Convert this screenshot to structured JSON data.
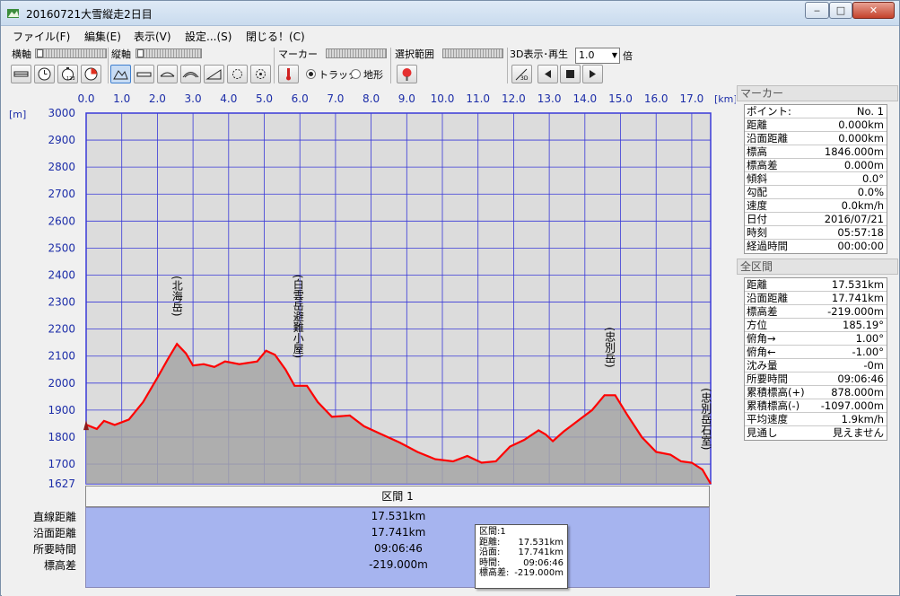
{
  "window": {
    "title": "20160721大雪縦走2日目",
    "min_label": "‒",
    "max_label": "□",
    "close_label": "✕"
  },
  "menu": [
    "ファイル(F)",
    "編集(E)",
    "表示(V)",
    "設定...(S)",
    "閉じる！(C)"
  ],
  "toolbar": {
    "x_axis_label": "横軸",
    "y_axis_label": "縦軸",
    "marker_label": "マーカー",
    "track_label": "トラック",
    "terrain_label": "地形",
    "selection_label": "選択範囲",
    "play3d_label": "3D表示･再生",
    "speed_value": "1.0",
    "speed_unit": "倍",
    "speed_options_icon": "chevron-down-icon",
    "x_buttons": [
      "horizontal-distance-icon",
      "clock-icon",
      "stopwatch-icon",
      "pie-icon"
    ],
    "y_buttons": [
      "mountain-icon",
      "flat-icon",
      "arc-icon",
      "wide-arc-icon",
      "slope-icon",
      "gear-icon",
      "gear2-icon"
    ],
    "marker_btn_icon": "thermometer-icon",
    "selection_btn_icon": "pin-icon",
    "play_buttons": [
      "3d-view-icon",
      "rewind-icon",
      "stop-icon",
      "play-icon"
    ]
  },
  "chart_data": {
    "type": "area",
    "x_unit": "[km]",
    "y_unit": "[m]",
    "x_ticks": [
      "0.0",
      "1.0",
      "2.0",
      "3.0",
      "4.0",
      "5.0",
      "6.0",
      "7.0",
      "8.0",
      "9.0",
      "10.0",
      "11.0",
      "12.0",
      "13.0",
      "14.0",
      "15.0",
      "16.0",
      "17.0"
    ],
    "y_ticks": [
      "3000",
      "2900",
      "2800",
      "2700",
      "2600",
      "2500",
      "2400",
      "2300",
      "2200",
      "2100",
      "2000",
      "1900",
      "1800",
      "1700",
      "1627"
    ],
    "xlim": [
      0,
      17.531
    ],
    "ylim": [
      1627,
      3000
    ],
    "fill_color": "#a6a6a6",
    "line_color": "#ff0000",
    "plot_bg": "#dcdcdc",
    "grid_color": "#3a3ad8",
    "points": [
      [
        0.0,
        1846
      ],
      [
        0.3,
        1830
      ],
      [
        0.5,
        1860
      ],
      [
        0.8,
        1845
      ],
      [
        1.2,
        1865
      ],
      [
        1.6,
        1930
      ],
      [
        2.0,
        2020
      ],
      [
        2.3,
        2090
      ],
      [
        2.55,
        2145
      ],
      [
        2.8,
        2110
      ],
      [
        3.0,
        2065
      ],
      [
        3.3,
        2070
      ],
      [
        3.6,
        2060
      ],
      [
        3.9,
        2080
      ],
      [
        4.3,
        2070
      ],
      [
        4.8,
        2080
      ],
      [
        5.05,
        2120
      ],
      [
        5.3,
        2105
      ],
      [
        5.6,
        2050
      ],
      [
        5.85,
        1990
      ],
      [
        6.2,
        1990
      ],
      [
        6.5,
        1930
      ],
      [
        6.9,
        1875
      ],
      [
        7.4,
        1880
      ],
      [
        7.8,
        1840
      ],
      [
        8.3,
        1810
      ],
      [
        8.8,
        1780
      ],
      [
        9.3,
        1745
      ],
      [
        9.8,
        1718
      ],
      [
        10.3,
        1710
      ],
      [
        10.7,
        1730
      ],
      [
        11.1,
        1705
      ],
      [
        11.5,
        1710
      ],
      [
        11.9,
        1765
      ],
      [
        12.3,
        1790
      ],
      [
        12.7,
        1825
      ],
      [
        12.9,
        1810
      ],
      [
        13.1,
        1785
      ],
      [
        13.4,
        1820
      ],
      [
        13.8,
        1860
      ],
      [
        14.2,
        1900
      ],
      [
        14.55,
        1955
      ],
      [
        14.85,
        1955
      ],
      [
        15.2,
        1880
      ],
      [
        15.6,
        1800
      ],
      [
        16.0,
        1745
      ],
      [
        16.4,
        1735
      ],
      [
        16.7,
        1710
      ],
      [
        17.0,
        1705
      ],
      [
        17.3,
        1680
      ],
      [
        17.531,
        1627
      ]
    ],
    "peaks": [
      {
        "label": "(北海岳)",
        "km": 2.55,
        "elev": 2145
      },
      {
        "label": "(白雲岳避難小屋)",
        "km": 5.95,
        "elev": 1990
      },
      {
        "label": "(忠別岳)",
        "km": 14.7,
        "elev": 1955
      },
      {
        "label": "(忠別岳石室)",
        "km": 17.4,
        "elev": 1650
      }
    ]
  },
  "interval": {
    "header": "区間 1",
    "rows": [
      {
        "label": "直線距離",
        "value": "17.531km"
      },
      {
        "label": "沿面距離",
        "value": "17.741km"
      },
      {
        "label": "所要時間",
        "value": "09:06:46"
      },
      {
        "label": "標高差",
        "value": "-219.000m"
      }
    ]
  },
  "tooltip": {
    "title": "区間:1",
    "rows": [
      {
        "k": "距離:",
        "v": "17.531km"
      },
      {
        "k": "沿面:",
        "v": "17.741km"
      },
      {
        "k": "時間:",
        "v": "09:06:46"
      },
      {
        "k": "標高差:",
        "v": "-219.000m"
      }
    ]
  },
  "side": {
    "marker_header": "マーカー",
    "marker_rows": [
      {
        "k": "ポイント:",
        "v": "No. 1"
      },
      {
        "k": "距離",
        "v": "0.000km"
      },
      {
        "k": "沿面距離",
        "v": "0.000km"
      },
      {
        "k": "標高",
        "v": "1846.000m"
      },
      {
        "k": "標高差",
        "v": "0.000m"
      },
      {
        "k": "傾斜",
        "v": "0.0°"
      },
      {
        "k": "勾配",
        "v": "0.0%"
      },
      {
        "k": "速度",
        "v": "0.0km/h"
      },
      {
        "k": "日付",
        "v": "2016/07/21"
      },
      {
        "k": "時刻",
        "v": "05:57:18"
      },
      {
        "k": "経過時間",
        "v": "00:00:00"
      }
    ],
    "all_header": "全区間",
    "all_rows": [
      {
        "k": "距離",
        "v": "17.531km"
      },
      {
        "k": "沿面距離",
        "v": "17.741km"
      },
      {
        "k": "標高差",
        "v": "-219.000m"
      },
      {
        "k": "方位",
        "v": "185.19°"
      },
      {
        "k": "俯角→",
        "v": "1.00°"
      },
      {
        "k": "俯角←",
        "v": "-1.00°"
      },
      {
        "k": "沈み量",
        "v": "-0m"
      },
      {
        "k": "所要時間",
        "v": "09:06:46"
      },
      {
        "k": "累積標高(+)",
        "v": "878.000m"
      },
      {
        "k": "累積標高(-)",
        "v": "-1097.000m"
      },
      {
        "k": "平均速度",
        "v": "1.9km/h"
      },
      {
        "k": "見通し",
        "v": "見えません"
      }
    ]
  }
}
